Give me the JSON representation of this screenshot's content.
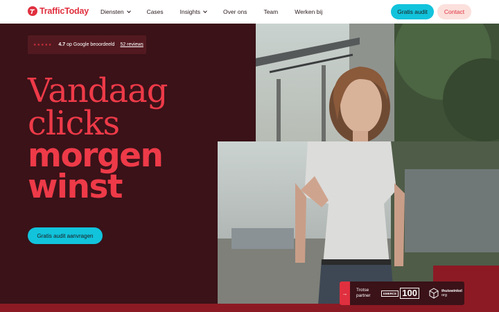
{
  "brand": {
    "name": "TrafficToday",
    "color": "#e0303f"
  },
  "nav": {
    "items": [
      {
        "label": "Diensten",
        "dropdown": true
      },
      {
        "label": "Cases",
        "dropdown": false
      },
      {
        "label": "Insights",
        "dropdown": true
      },
      {
        "label": "Over ons",
        "dropdown": false
      },
      {
        "label": "Team",
        "dropdown": false
      },
      {
        "label": "Werken bij",
        "dropdown": false
      }
    ],
    "audit_button": "Gratis audit",
    "contact_button": "Contact"
  },
  "rating": {
    "stars": "★★★★★",
    "score": "4.7",
    "text": "op Google beoordeeld",
    "reviews_link": "52 reviews"
  },
  "hero": {
    "line1": "Vandaag",
    "line2": "clicks",
    "line3": "morgen",
    "line4": "winst",
    "cta": "Gratis audit aanvragen"
  },
  "partner": {
    "arrow_icon": "arrow-right-icon",
    "line1": "Trotse",
    "line2": "partner",
    "emerce_label": "EMERCE",
    "emerce_number": "100",
    "thuiswinkel_name": "thuiswinkel",
    "thuiswinkel_sub": "org"
  },
  "colors": {
    "accent_cyan": "#12c3dc",
    "hero_bg": "#3a1218",
    "headline": "#ee3a48",
    "deep_red": "#8c1a24"
  }
}
